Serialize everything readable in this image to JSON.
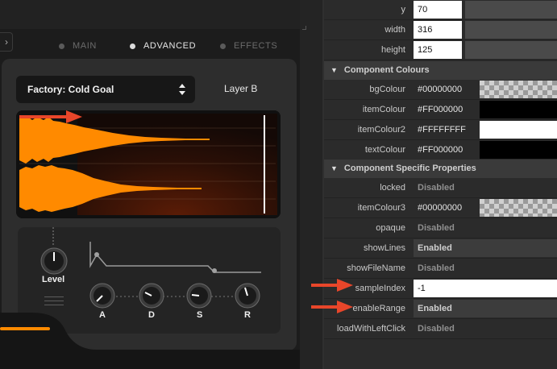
{
  "plugin": {
    "collapse_glyph": "›",
    "tabs": [
      {
        "label": "MAIN",
        "active": false
      },
      {
        "label": "ADVANCED",
        "active": true
      },
      {
        "label": "EFFECTS",
        "active": false
      }
    ],
    "preset_label": "Factory: Cold Goal",
    "layer_label": "Layer B",
    "level_label": "Level",
    "envelope_knobs": [
      "A",
      "D",
      "S",
      "R"
    ],
    "accent_color": "#ff8a00"
  },
  "inspector": {
    "top_rows": [
      {
        "name": "y",
        "value": "70"
      },
      {
        "name": "width",
        "value": "316"
      },
      {
        "name": "height",
        "value": "125"
      }
    ],
    "sections": [
      {
        "title": "Component Colours",
        "rows": [
          {
            "name": "bgColour",
            "value": "#00000000",
            "swatch": "transparent"
          },
          {
            "name": "itemColour",
            "value": "#FF000000",
            "swatch": "black"
          },
          {
            "name": "itemColour2",
            "value": "#FFFFFFFF",
            "swatch": "white"
          },
          {
            "name": "textColour",
            "value": "#FF000000",
            "swatch": "black"
          }
        ]
      },
      {
        "title": "Component Specific Properties",
        "rows": [
          {
            "name": "locked",
            "value": "Disabled"
          },
          {
            "name": "itemColour3",
            "value": "#00000000",
            "swatch": "transparent"
          },
          {
            "name": "opaque",
            "value": "Disabled"
          },
          {
            "name": "showLines",
            "value": "Enabled"
          },
          {
            "name": "showFileName",
            "value": "Disabled"
          },
          {
            "name": "sampleIndex",
            "value": "-1"
          },
          {
            "name": "enableRange",
            "value": "Enabled"
          },
          {
            "name": "loadWithLeftClick",
            "value": "Disabled"
          }
        ]
      }
    ]
  },
  "annotations": {
    "arrow_color": "#e8462a"
  }
}
